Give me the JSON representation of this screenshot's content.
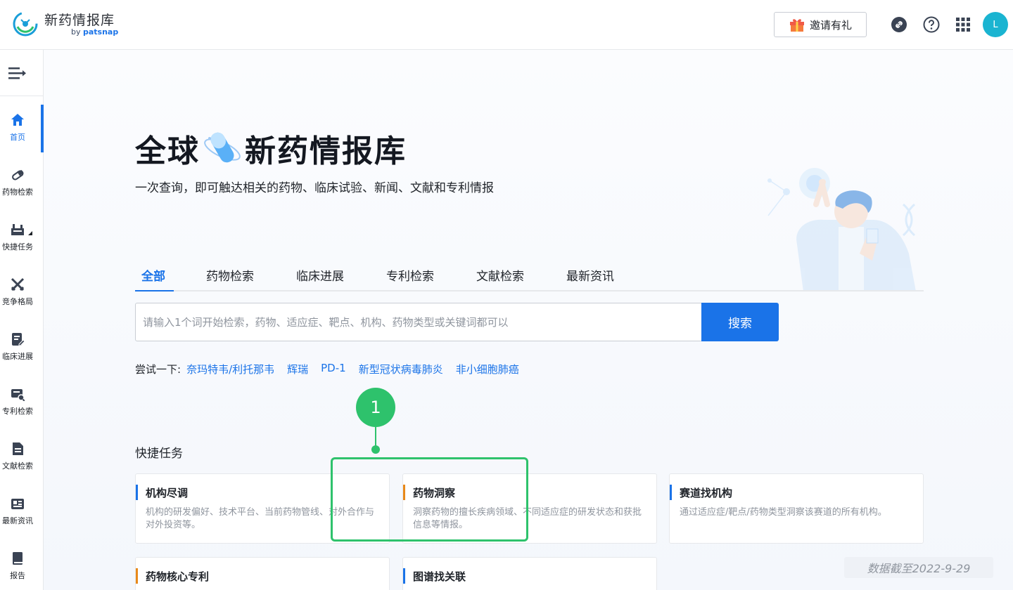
{
  "brand": {
    "title": "新药情报库",
    "sub_prefix": "by ",
    "sub_brand": "patsnap"
  },
  "header": {
    "invite_label": "邀请有礼",
    "avatar_letter": "L"
  },
  "sidebar": {
    "items": [
      {
        "label": "首页",
        "active": true
      },
      {
        "label": "药物检索"
      },
      {
        "label": "快捷任务"
      },
      {
        "label": "竞争格局"
      },
      {
        "label": "临床进展"
      },
      {
        "label": "专利检索"
      },
      {
        "label": "文献检索"
      },
      {
        "label": "最新资讯"
      },
      {
        "label": "报告"
      }
    ]
  },
  "hero": {
    "title_left": "全球",
    "title_right": "新药情报库",
    "subtitle": "一次查询，即可触达相关的药物、临床试验、新闻、文献和专利情报"
  },
  "tabs": [
    "全部",
    "药物检索",
    "临床进展",
    "专利检索",
    "文献检索",
    "最新资讯"
  ],
  "search": {
    "placeholder": "请输入1个词开始检索，药物、适应症、靶点、机构、药物类型或关键词都可以",
    "button": "搜索"
  },
  "try": {
    "label": "尝试一下:",
    "links": [
      "奈玛特韦/利托那韦",
      "辉瑞",
      "PD-1",
      "新型冠状病毒肺炎",
      "非小细胞肺癌"
    ]
  },
  "callout": {
    "number": "1"
  },
  "quick": {
    "title": "快捷任务",
    "cards": [
      {
        "title": "机构尽调",
        "desc": "机构的研发偏好、技术平台、当前药物管线、对外合作与对外投资等。",
        "color": "#1a73e8"
      },
      {
        "title": "药物洞察",
        "desc": "洞察药物的擅长疾病领域、不同适应症的研发状态和获批信息等情报。",
        "color": "#e8891a"
      },
      {
        "title": "赛道找机构",
        "desc": "通过适应症/靶点/药物类型洞察该赛道的所有机构。",
        "color": "#1a73e8"
      },
      {
        "title": "药物核心专利",
        "desc": "",
        "color": "#e8891a"
      },
      {
        "title": "图谱找关联",
        "desc": "",
        "color": "#1a73e8"
      }
    ]
  },
  "data_date": "数据截至2022-9-29"
}
